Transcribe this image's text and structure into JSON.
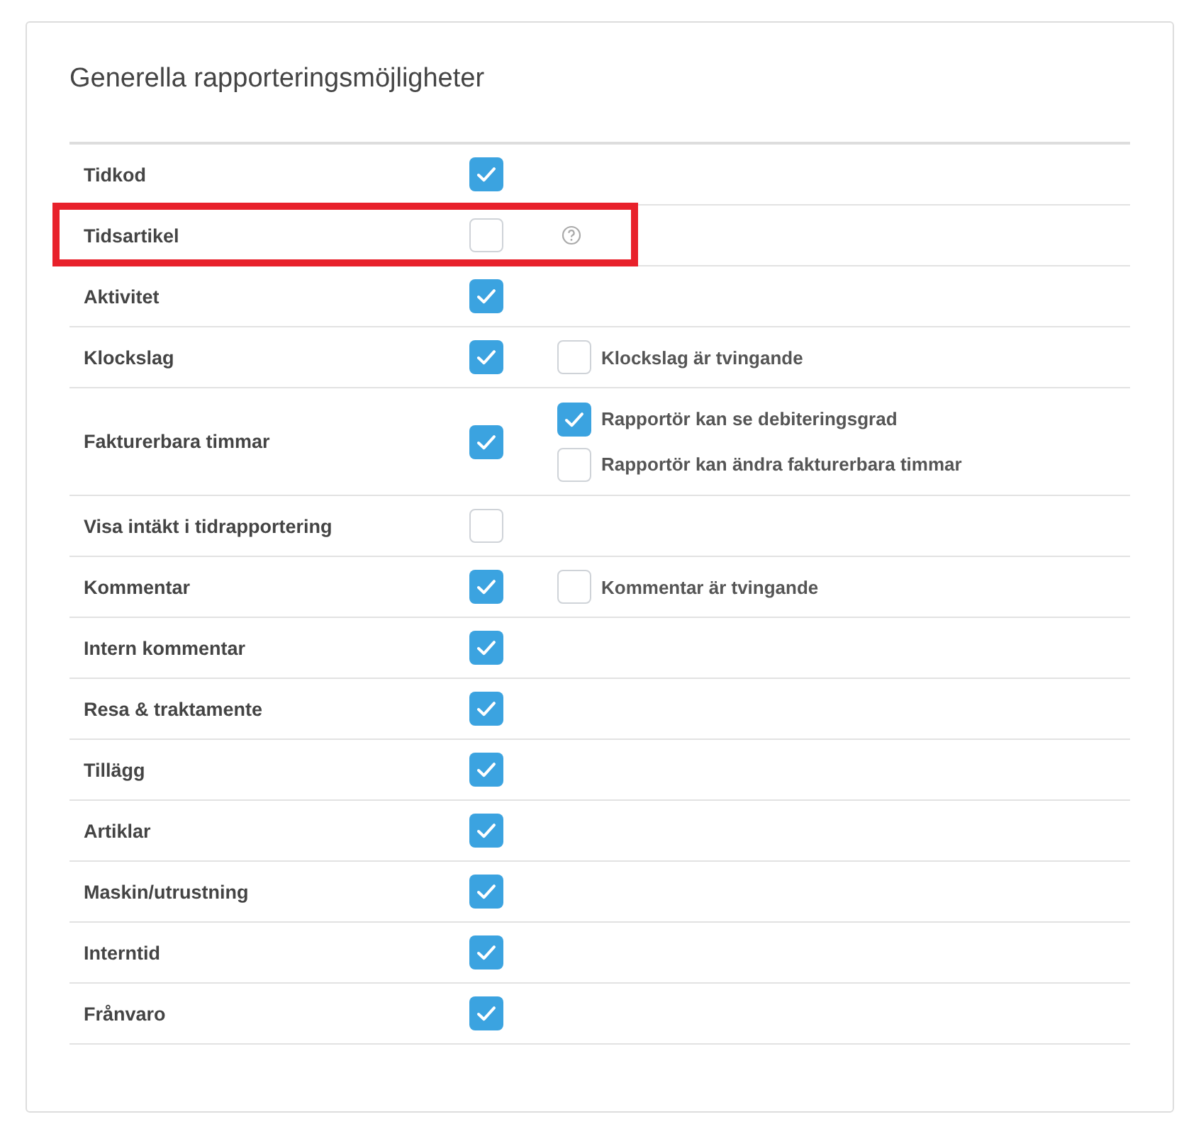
{
  "title": "Generella rapporteringsmöjligheter",
  "rows": [
    {
      "label": "Tidkod",
      "checked": true
    },
    {
      "label": "Tidsartikel",
      "checked": false,
      "help": true,
      "highlighted": true
    },
    {
      "label": "Aktivitet",
      "checked": true
    },
    {
      "label": "Klockslag",
      "checked": true,
      "options": [
        {
          "label": "Klockslag är tvingande",
          "checked": false
        }
      ]
    },
    {
      "label": "Fakturerbara timmar",
      "checked": true,
      "options": [
        {
          "label": "Rapportör kan se debiteringsgrad",
          "checked": true
        },
        {
          "label": "Rapportör kan ändra fakturerbara timmar",
          "checked": false
        }
      ]
    },
    {
      "label": "Visa intäkt i tidrapportering",
      "checked": false
    },
    {
      "label": "Kommentar",
      "checked": true,
      "options": [
        {
          "label": "Kommentar är tvingande",
          "checked": false
        }
      ]
    },
    {
      "label": "Intern kommentar",
      "checked": true
    },
    {
      "label": "Resa & traktamente",
      "checked": true
    },
    {
      "label": "Tillägg",
      "checked": true
    },
    {
      "label": "Artiklar",
      "checked": true
    },
    {
      "label": "Maskin/utrustning",
      "checked": true
    },
    {
      "label": "Interntid",
      "checked": true
    },
    {
      "label": "Frånvaro",
      "checked": true
    }
  ]
}
